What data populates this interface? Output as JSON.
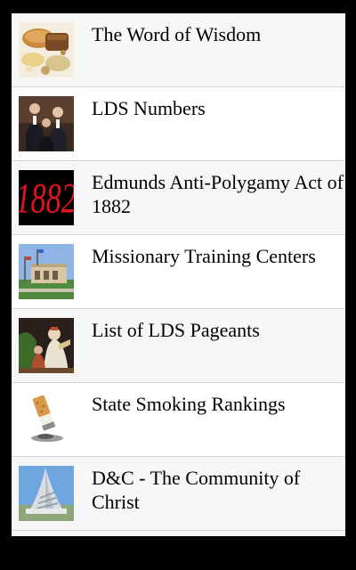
{
  "list": {
    "items": [
      {
        "title": "The Word of Wisdom",
        "thumb_icon": "bread-grains-thumbnail"
      },
      {
        "title": "LDS Numbers",
        "thumb_icon": "church-leaders-photo-thumbnail"
      },
      {
        "title": "Edmunds Anti-Polygamy Act of 1882",
        "thumb_icon": "red-1882-text-thumbnail",
        "thumb_text": "1882"
      },
      {
        "title": "Missionary Training Centers",
        "thumb_icon": "training-center-building-thumbnail"
      },
      {
        "title": "List of LDS Pageants",
        "thumb_icon": "pageant-performers-thumbnail"
      },
      {
        "title": "State Smoking Rankings",
        "thumb_icon": "cigarette-butt-thumbnail"
      },
      {
        "title": "D&C - The Community of Christ",
        "thumb_icon": "temple-spire-thumbnail"
      }
    ]
  },
  "colors": {
    "frame": "#000000",
    "row_alt": "#f7f7f7",
    "row": "#ffffff",
    "divider": "#d6d6d6",
    "accent_red": "#e0141c"
  }
}
